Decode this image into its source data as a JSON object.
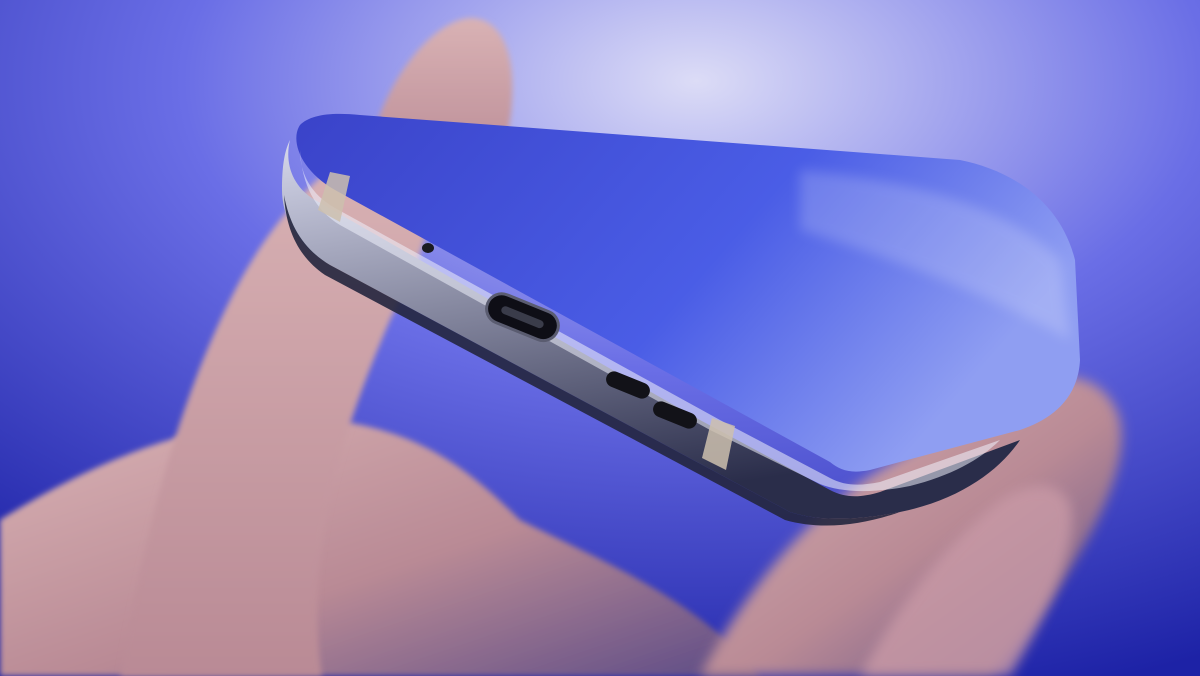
{
  "photo": {
    "subject": "",
    "colors": {
      "backdrop_light": "#dcdcf6",
      "backdrop_mid": "#6a6ee6",
      "backdrop_dark": "#1d22a6",
      "skin_light": "#d9b2b4",
      "skin_mid": "#b98a95",
      "skin_shadow": "#5b4a86",
      "frame_light": "#d7d9ec",
      "frame_dark": "#2a2d4a",
      "screen_glass": "#3e4ddb",
      "port_black": "#101018"
    }
  }
}
